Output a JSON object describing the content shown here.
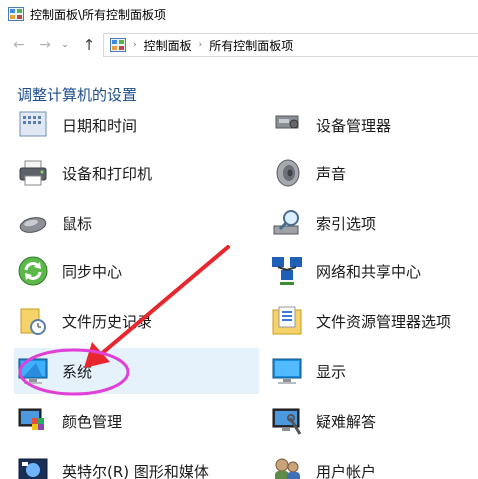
{
  "window": {
    "title": "控制面板\\所有控制面板项"
  },
  "nav": {
    "back_glyph": "←",
    "forward_glyph": "→",
    "recent_glyph": "⌄",
    "up_glyph": "↑",
    "breadcrumb": [
      "控制面板",
      "所有控制面板项"
    ],
    "separator": "›"
  },
  "heading": "调整计算机的设置",
  "items": [
    {
      "label": "日期和时间",
      "icon": "calendar-clock-icon",
      "column": "left"
    },
    {
      "label": "设备管理器",
      "icon": "device-manager-icon",
      "column": "right"
    },
    {
      "label": "设备和打印机",
      "icon": "printer-icon",
      "column": "left"
    },
    {
      "label": "声音",
      "icon": "speaker-icon",
      "column": "right"
    },
    {
      "label": "鼠标",
      "icon": "mouse-icon",
      "column": "left"
    },
    {
      "label": "索引选项",
      "icon": "index-search-icon",
      "column": "right"
    },
    {
      "label": "同步中心",
      "icon": "sync-icon",
      "column": "left"
    },
    {
      "label": "网络和共享中心",
      "icon": "network-icon",
      "column": "right"
    },
    {
      "label": "文件历史记录",
      "icon": "file-history-icon",
      "column": "left"
    },
    {
      "label": "文件资源管理器选项",
      "icon": "folder-options-icon",
      "column": "right"
    },
    {
      "label": "系统",
      "icon": "system-monitor-icon",
      "column": "left",
      "selected": true
    },
    {
      "label": "显示",
      "icon": "display-icon",
      "column": "right"
    },
    {
      "label": "颜色管理",
      "icon": "color-management-icon",
      "column": "left"
    },
    {
      "label": "疑难解答",
      "icon": "troubleshooting-icon",
      "column": "right"
    },
    {
      "label": "英特尔(R) 图形和媒体",
      "icon": "intel-graphics-icon",
      "column": "left"
    },
    {
      "label": "用户帐户",
      "icon": "user-accounts-icon",
      "column": "right"
    }
  ],
  "colors": {
    "heading": "#1e4e8c",
    "selection": "#e5f1fb",
    "annotation_arrow": "#e8262d",
    "annotation_circle": "#e040d8"
  }
}
